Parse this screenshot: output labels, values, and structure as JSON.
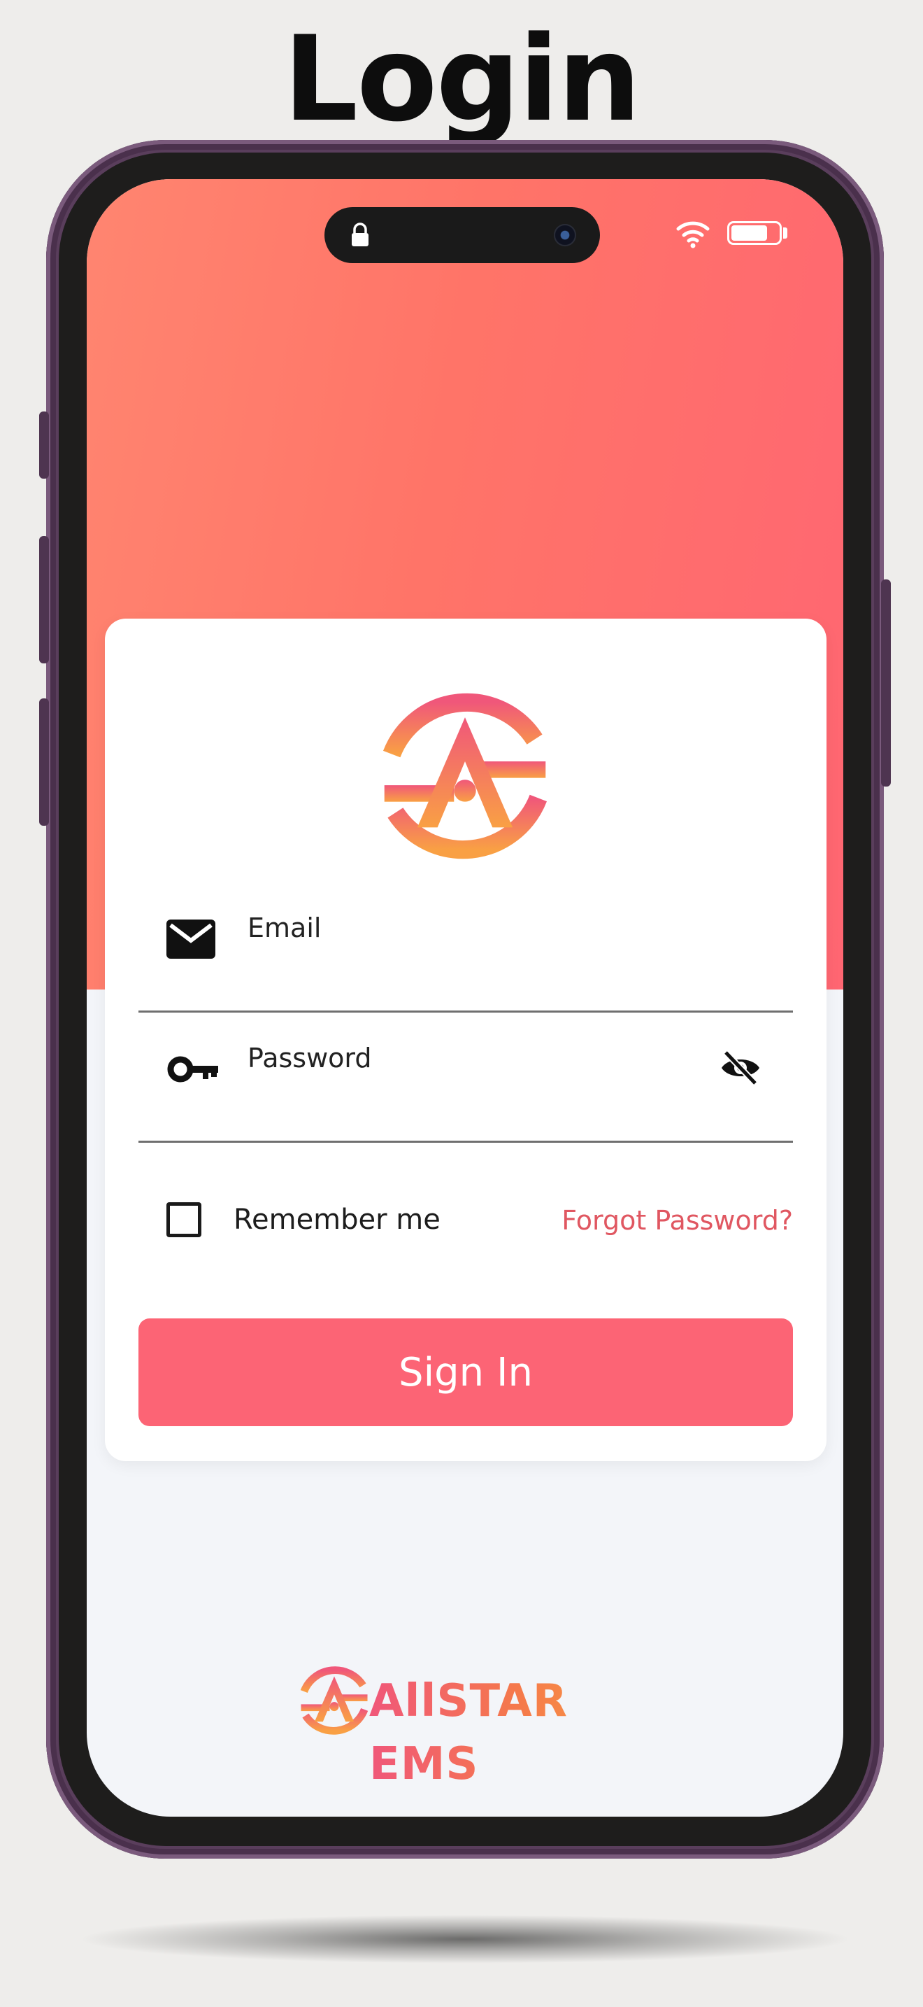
{
  "page_heading": "Login",
  "status_bar": {
    "lock_icon": "lock-icon",
    "wifi_icon": "wifi-icon",
    "battery_icon": "battery-icon",
    "battery_level": 0.78
  },
  "login_form": {
    "logo_icon": "allstar-logo-icon",
    "email": {
      "placeholder": "Email",
      "value": "",
      "icon": "mail-icon"
    },
    "password": {
      "placeholder": "Password",
      "value": "",
      "icon": "key-icon",
      "visibility_icon": "eye-slash-icon"
    },
    "remember_me": {
      "label": "Remember me",
      "checked": false
    },
    "forgot_password": "Forgot Password?",
    "sign_in": "Sign In"
  },
  "footer": {
    "brand_icon": "allstar-logo-icon",
    "brand_name": "AllSTAR EMS"
  },
  "colors": {
    "hero_start": "#ff8570",
    "hero_end": "#ff6672",
    "accent": "#fc6475",
    "link": "#e05761",
    "brand_orange": "#f9a044",
    "brand_pink": "#f0577a"
  }
}
